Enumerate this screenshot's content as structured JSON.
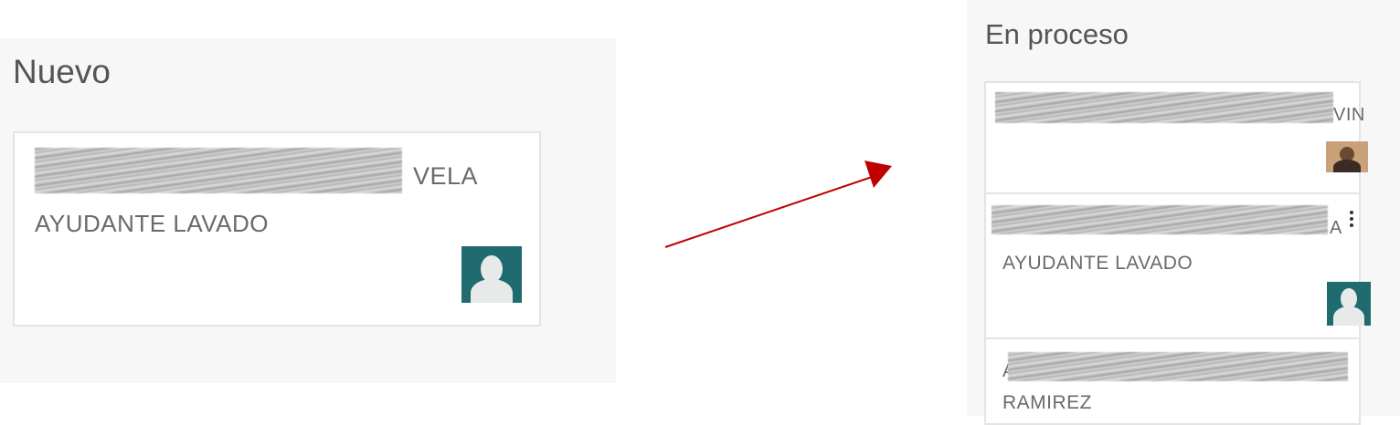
{
  "left_column": {
    "title": "Nuevo",
    "card": {
      "name_suffix": "VELA",
      "role": "AYUDANTE LAVADO"
    }
  },
  "right_column": {
    "title": "En proceso",
    "cards": [
      {
        "name_suffix": "VIN",
        "avatar": "photo"
      },
      {
        "name_suffix": "A",
        "role": "AYUDANTE LAVADO",
        "avatar": "default-user-icon"
      },
      {
        "name_prefix": "A",
        "second_line": "RAMIREZ"
      }
    ]
  },
  "colors": {
    "column_bg": "#f7f7f7",
    "card_border": "#e4e4e4",
    "avatar_bg": "#1f6b70",
    "arrow": "#c00000",
    "text": "#6a6a6a"
  },
  "icons": [
    "default-user-icon",
    "kebab-menu-icon",
    "arrow-icon"
  ]
}
